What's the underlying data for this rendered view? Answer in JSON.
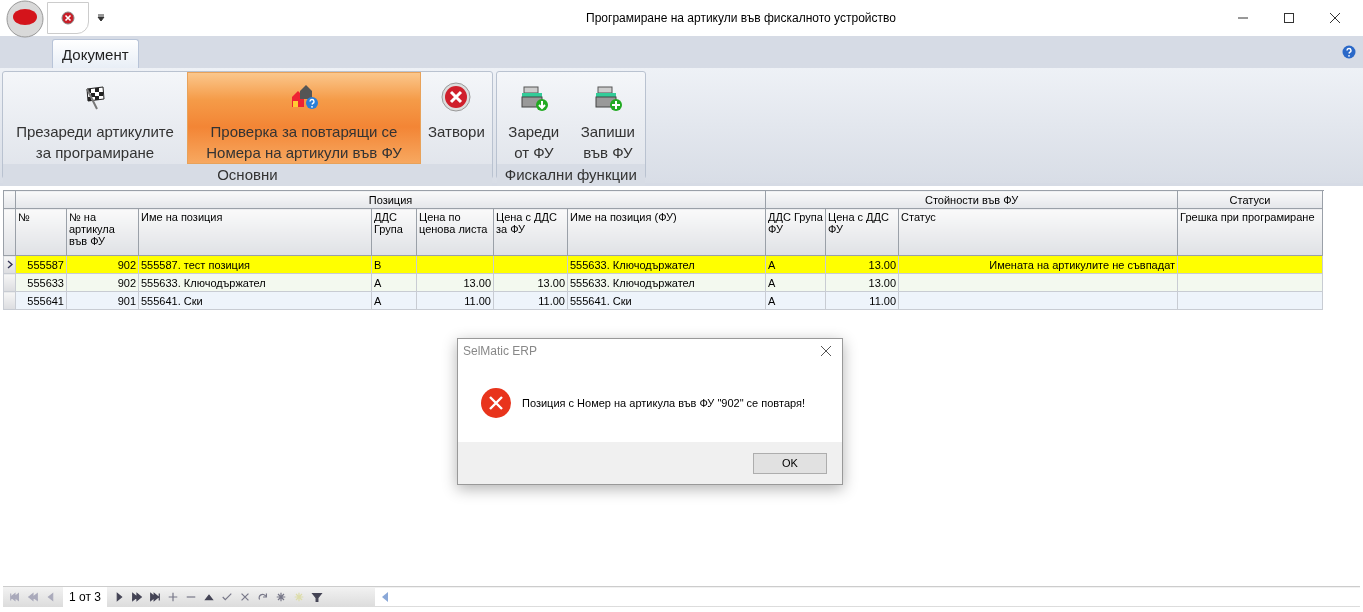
{
  "window": {
    "title": "Програмиране на артикули във фискалното устройство"
  },
  "tabs": [
    {
      "label": "Документ",
      "selected": true
    }
  ],
  "ribbon_groups": [
    {
      "label": "Основни",
      "buttons": [
        {
          "label": "Презареди артикулите за програмиране",
          "highlighted": false
        },
        {
          "label": "Проверка за повтарящи се Номера на артикули във ФУ",
          "highlighted": true
        },
        {
          "label": "Затвори",
          "highlighted": false
        }
      ]
    },
    {
      "label": "Фискални функции",
      "buttons": [
        {
          "label": "Зареди от ФУ",
          "highlighted": false
        },
        {
          "label": "Запиши във ФУ",
          "highlighted": false
        }
      ]
    }
  ],
  "table": {
    "bands": [
      {
        "label": "Позиция"
      },
      {
        "label": "Стойности във ФУ"
      },
      {
        "label": "Статуси"
      }
    ],
    "columns": [
      {
        "label": "№"
      },
      {
        "label": "№ на артикула във ФУ"
      },
      {
        "label": "Име на позиция"
      },
      {
        "label": "ДДС Група"
      },
      {
        "label": "Цена по ценова листа"
      },
      {
        "label": "Цена с ДДС за ФУ"
      },
      {
        "label": "Име на позиция (ФУ)"
      },
      {
        "label": "ДДС Група ФУ"
      },
      {
        "label": "Цена с ДДС ФУ"
      },
      {
        "label": "Статус"
      },
      {
        "label": "Грешка при програмиране"
      }
    ],
    "rows": [
      {
        "selected": true,
        "highlighted": true,
        "cells": [
          "555587",
          "902",
          "555587. тест позиция",
          "B",
          "",
          "",
          "555633. Ключодържател",
          "A",
          "13.00",
          "Имената на артикулите не съвпадат",
          ""
        ]
      },
      {
        "selected": false,
        "highlighted": false,
        "cells": [
          "555633",
          "902",
          "555633. Ключодържател",
          "A",
          "13.00",
          "13.00",
          "555633. Ключодържател",
          "A",
          "13.00",
          "",
          ""
        ]
      },
      {
        "selected": false,
        "highlighted": false,
        "cells": [
          "555641",
          "901",
          "555641. Ски",
          "A",
          "11.00",
          "11.00",
          "555641. Ски",
          "A",
          "11.00",
          "",
          ""
        ]
      }
    ]
  },
  "navigator": {
    "position": "1 от 3"
  },
  "dialog": {
    "title": "SelMatic ERP",
    "message": "Позиция с Номер на артикула във ФУ \"902\" се повтаря!",
    "buttons": [
      "OK"
    ]
  }
}
